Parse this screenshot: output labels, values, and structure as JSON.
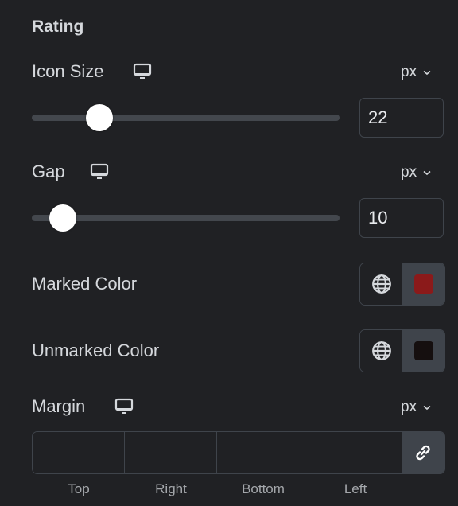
{
  "section": {
    "title": "Rating"
  },
  "icon_size": {
    "label": "Icon Size",
    "device_icon": "desktop-monitor-icon",
    "unit": "px",
    "value": "22",
    "slider_percent": 22
  },
  "gap": {
    "label": "Gap",
    "device_icon": "desktop-monitor-icon",
    "unit": "px",
    "value": "10",
    "slider_percent": 10
  },
  "marked_color": {
    "label": "Marked Color",
    "global_icon": "globe-icon",
    "color": "#8b1a1a"
  },
  "unmarked_color": {
    "label": "Unmarked Color",
    "global_icon": "globe-icon",
    "color": "#150f0f"
  },
  "margin": {
    "label": "Margin",
    "device_icon": "desktop-monitor-icon",
    "unit": "px",
    "fields": [
      {
        "label": "Top",
        "value": ""
      },
      {
        "label": "Right",
        "value": ""
      },
      {
        "label": "Bottom",
        "value": ""
      },
      {
        "label": "Left",
        "value": ""
      }
    ],
    "link_icon": "link-icon"
  }
}
